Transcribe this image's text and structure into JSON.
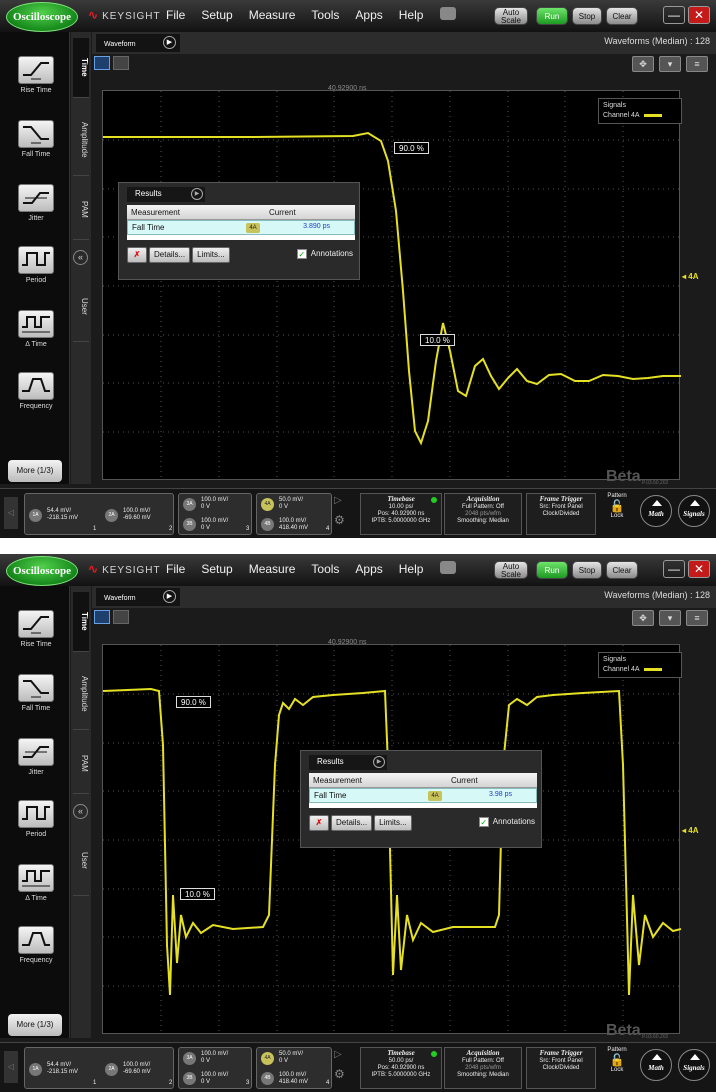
{
  "app": {
    "oscilloscope_label": "Oscilloscope",
    "brand": "KEYSIGHT",
    "menus": [
      "File",
      "Setup",
      "Measure",
      "Tools",
      "Apps",
      "Help"
    ],
    "auto_scale": "Auto Scale",
    "run": "Run",
    "stop": "Stop",
    "clear": "Clear",
    "minimize": "—",
    "close": "✕"
  },
  "side": {
    "items": [
      "Rise Time",
      "Fall Time",
      "Jitter",
      "Period",
      "Δ Time",
      "Frequency"
    ],
    "more": "More (1/3)",
    "tabs": [
      "Time",
      "Amplitude",
      "PAM",
      "User"
    ],
    "collapse": "«"
  },
  "waveform": {
    "tab": "Waveform",
    "count": "Waveforms (Median) : 128",
    "trigger_pos": "40.92900 ns",
    "legend_title": "Signals",
    "legend_channel": "Channel 4A",
    "channel_marker": "◂ 4A",
    "beta": "Beta",
    "version": "P.03.60.202"
  },
  "panels": [
    {
      "results_title": "Results",
      "col_measurement": "Measurement",
      "col_current": "Current",
      "row_name": "Fall Time",
      "row_channel": "4A",
      "row_value": "3.890 ps",
      "btn_x": "✗",
      "btn_details": "Details...",
      "btn_limits": "Limits...",
      "annotations": "Annotations",
      "callout_90": "90.0 %",
      "callout_10": "10.0 %"
    },
    {
      "results_title": "Results",
      "col_measurement": "Measurement",
      "col_current": "Current",
      "row_name": "Fall Time",
      "row_channel": "4A",
      "row_value": "3.98 ps",
      "btn_x": "✗",
      "btn_details": "Details...",
      "btn_limits": "Limits...",
      "annotations": "Annotations",
      "callout_90": "90.0 %",
      "callout_10": "10.0 %"
    }
  ],
  "status": {
    "c1a_name": "1A",
    "c1a_v1": "54.4 mV/",
    "c1a_v2": "-218.15 mV",
    "c2a_name": "2A",
    "c2a_v1": "100.0 mV/",
    "c2a_v2": "-69.60 mV",
    "c3a_name": "3A",
    "c3a_v1": "100.0 mV/",
    "c3a_v2": "0 V",
    "c3b_name": "3B",
    "c3b_v1": "100.0 mV/",
    "c3b_v2": "0 V",
    "c4a_name": "4A",
    "c4a_v1": "50.0 mV/",
    "c4a_v2": "0 V",
    "c4b_name": "4B",
    "c4b_v1": "100.0 mV/",
    "c4b_v2": "418.40 mV",
    "slot1": "1",
    "slot2": "2",
    "slot3": "3",
    "slot4": "4",
    "timebase_title": "Timebase",
    "timebase_scale": [
      "10.00 ps/",
      "50.00 ps/"
    ],
    "timebase_pos": "Pos: 40.92900 ns",
    "timebase_iptb": "IPTB: 5.0000000 GHz",
    "acq_title": "Acquisition",
    "acq_full": "Full Pattern: Off",
    "acq_pts": "2048 pts/wfm",
    "acq_smooth": "Smoothing: Median",
    "trig_title": "Frame Trigger",
    "trig_src": "Src: Front Panel",
    "trig_clock": "Clock/Divided",
    "pattern": "Pattern",
    "lock": "Lock",
    "math": "Math",
    "signals": "Signals"
  },
  "colors": {
    "trace": "#e5e024",
    "accent": "#22aa22",
    "brand": "#e31b23"
  }
}
